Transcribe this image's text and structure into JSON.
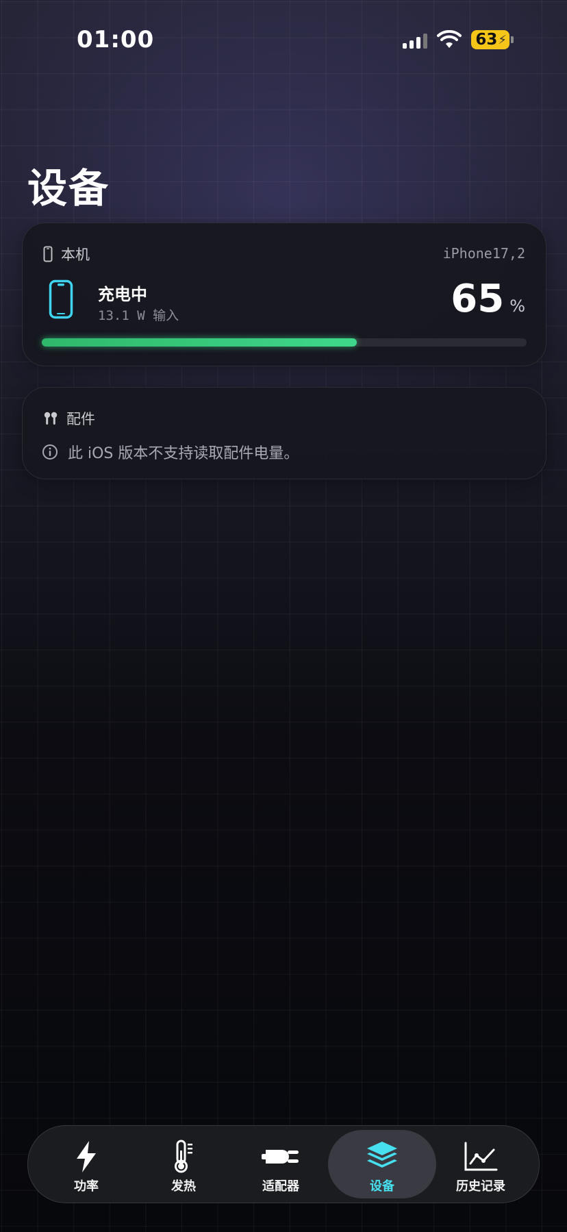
{
  "status_bar": {
    "time": "01:00",
    "battery_level": "63"
  },
  "page": {
    "title": "设备"
  },
  "device_card": {
    "label": "本机",
    "model": "iPhone17,2",
    "state": "充电中",
    "power_text": "13.1 W 输入",
    "percent": "65",
    "percent_unit": "%",
    "progress_fraction": 0.65
  },
  "accessories_card": {
    "label": "配件",
    "message": "此 iOS 版本不支持读取配件电量。"
  },
  "tabbar": {
    "items": [
      {
        "label": "功率",
        "icon": "bolt-icon"
      },
      {
        "label": "发热",
        "icon": "thermometer-icon"
      },
      {
        "label": "适配器",
        "icon": "plug-icon"
      },
      {
        "label": "设备",
        "icon": "layers-icon",
        "active": true
      },
      {
        "label": "历史记录",
        "icon": "chart-icon"
      }
    ]
  },
  "colors": {
    "accent": "#46e0f0",
    "progress": "#3fd88a",
    "battery_badge": "#f5c518"
  }
}
